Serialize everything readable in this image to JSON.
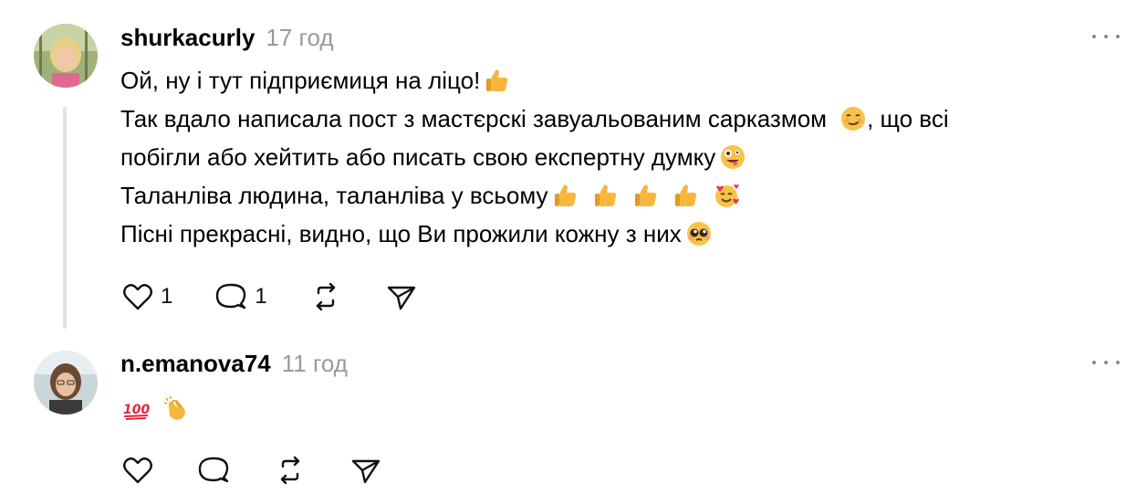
{
  "posts": [
    {
      "username": "shurkacurly",
      "timestamp": "17 год",
      "lines": [
        "Ой, ну і тут підприємиця на ліцо!",
        "Так вдало написала пост з мастєрскі завуальованим сарказмом",
        ", що всі",
        "побігли або хейтить або писать свою експертну думку",
        "Таланліва людина, таланліва у всьому",
        "Пісні прекрасні, видно, що Ви прожили кожну з них"
      ],
      "emojis": [
        "thumbs-up",
        "smirking-face",
        "zany-face",
        "thumbs-up",
        "smiling-face-with-hearts",
        "pleading-face"
      ],
      "likes": "1",
      "replies": "1"
    },
    {
      "username": "n.emanova74",
      "timestamp": "11 год",
      "emojis": [
        "hundred-points",
        "clapping-hands"
      ]
    }
  ],
  "colors": {
    "text": "#000000",
    "muted": "#999999",
    "thread_line": "#e2e2e2",
    "icon": "#111111"
  }
}
